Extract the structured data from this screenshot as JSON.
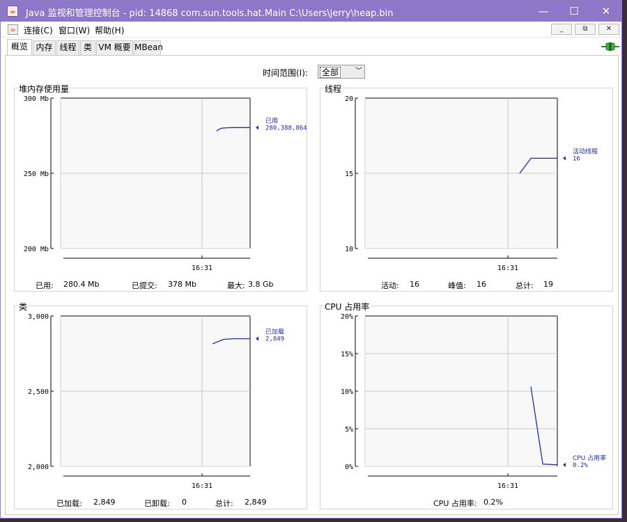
{
  "window": {
    "title": "Java 监视和管理控制台 - pid: 14868 com.sun.tools.hat.Main C:\\Users\\jerry\\heap.bin",
    "icon": "java-cup-icon",
    "controls": {
      "minimize": "—",
      "maximize": "☐",
      "close": "✕"
    }
  },
  "menubar": {
    "items": [
      "连接(C)",
      "窗口(W)",
      "帮助(H)"
    ],
    "inner_buttons": {
      "minimize": "_",
      "restore": "⧉",
      "close": "✕"
    }
  },
  "tabs": [
    {
      "label": "概览",
      "active": true
    },
    {
      "label": "内存",
      "active": false
    },
    {
      "label": "线程",
      "active": false
    },
    {
      "label": "类",
      "active": false
    },
    {
      "label": "VM 概要",
      "active": false
    },
    {
      "label": "MBean",
      "active": false
    }
  ],
  "connection_icon": "connection-plug-icon",
  "time_range": {
    "label": "时间范围(I):",
    "value": "全部"
  },
  "colors": {
    "series": "#1a2ea8",
    "grid": "#c8c8c8",
    "plot_bg": "#f8f8f8",
    "titlebar": "#8e76c8"
  },
  "panels": {
    "heap": {
      "title": "堆内存使用量",
      "stats": [
        {
          "label": "已用:",
          "value": "280.4 Mb"
        },
        {
          "label": "已提交:",
          "value": "378 Mb"
        },
        {
          "label": "最大:",
          "value": "3.8 Gb"
        }
      ]
    },
    "threads": {
      "title": "线程",
      "stats": [
        {
          "label": "活动:",
          "value": "16"
        },
        {
          "label": "峰值:",
          "value": "16"
        },
        {
          "label": "总计:",
          "value": "19"
        }
      ]
    },
    "classes": {
      "title": "类",
      "stats": [
        {
          "label": "已加载:",
          "value": "2,849"
        },
        {
          "label": "已卸载:",
          "value": "0"
        },
        {
          "label": "总计:",
          "value": "2,849"
        }
      ]
    },
    "cpu": {
      "title": "CPU 占用率",
      "stats": [
        {
          "label": "CPU 占用率:",
          "value": "0.2%"
        }
      ]
    }
  },
  "chart_data": [
    {
      "id": "heap",
      "type": "line",
      "ylim": [
        200,
        300
      ],
      "yticks": [
        200,
        250,
        300
      ],
      "ytick_labels": [
        "200 Mb",
        "250 Mb",
        "300 Mb"
      ],
      "xtick_labels": [
        "16:31"
      ],
      "series": [
        {
          "name": "已用",
          "value_label": "280,388,864",
          "x": [
            0,
            0.04,
            0.15,
            0.3,
            0.5,
            0.75,
            1.0
          ],
          "y": [
            278,
            279,
            280,
            280.3,
            280.4,
            280.4,
            280.4
          ]
        }
      ]
    },
    {
      "id": "threads",
      "type": "line",
      "ylim": [
        10,
        20
      ],
      "yticks": [
        10,
        15,
        20
      ],
      "ytick_labels": [
        "10",
        "15",
        "20"
      ],
      "xtick_labels": [
        "16:31"
      ],
      "series": [
        {
          "name": "活动线程",
          "value_label": "16",
          "x": [
            0,
            0.3,
            0.4,
            1.0
          ],
          "y": [
            15,
            16,
            16,
            16
          ]
        }
      ]
    },
    {
      "id": "classes",
      "type": "line",
      "ylim": [
        2000,
        3000
      ],
      "yticks": [
        2000,
        2500,
        3000
      ],
      "ytick_labels": [
        "2,000",
        "2,500",
        "3,000"
      ],
      "xtick_labels": [
        "16:31"
      ],
      "series": [
        {
          "name": "已加载",
          "value_label": "2,849",
          "x": [
            0,
            0.3,
            0.6,
            1.0
          ],
          "y": [
            2815,
            2845,
            2849,
            2849
          ]
        }
      ]
    },
    {
      "id": "cpu",
      "type": "line",
      "ylim": [
        0,
        20
      ],
      "yticks": [
        0,
        5,
        10,
        15,
        20
      ],
      "ytick_labels": [
        "0%",
        "5%",
        "10%",
        "15%",
        "20%"
      ],
      "xtick_labels": [
        "16:31"
      ],
      "series": [
        {
          "name": "CPU 占用率",
          "value_label": "0.2%",
          "x": [
            0,
            0.45,
            1.0
          ],
          "y": [
            10.6,
            0.3,
            0.2
          ]
        }
      ]
    }
  ]
}
